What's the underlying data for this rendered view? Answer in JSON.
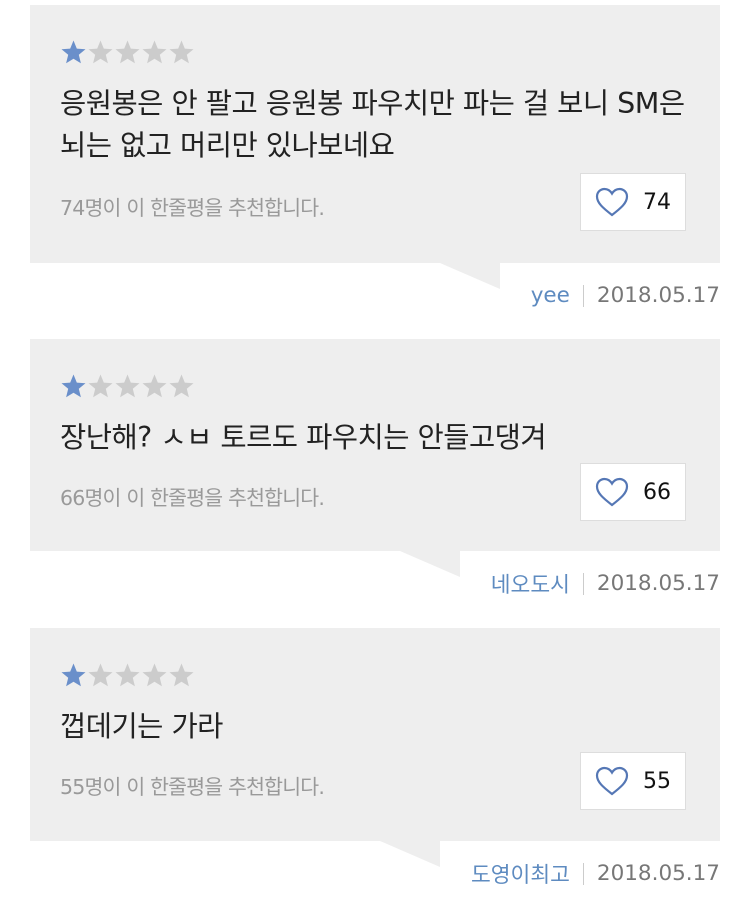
{
  "colors": {
    "bubble_bg": "#eeeeee",
    "star_filled": "#6a8fca",
    "star_empty": "#cccccc",
    "author_link": "#5e8bc0",
    "heart_outline": "#5577b5"
  },
  "icons": {
    "star": "star-icon",
    "heart": "heart-icon"
  },
  "reviews": [
    {
      "rating": 1,
      "max_rating": 5,
      "comment": "응원봉은 안 팔고 응원봉 파우치만 파는 걸 보니 SM은 뇌는 없고 머리만 있나보네요",
      "recommend_text": "74명이 이 한줄평을 추천합니다.",
      "likes": "74",
      "author": "yee",
      "date": "2018.05.17"
    },
    {
      "rating": 1,
      "max_rating": 5,
      "comment": "장난해? ㅅㅂ 토르도 파우치는 안들고댕겨",
      "recommend_text": "66명이 이 한줄평을 추천합니다.",
      "likes": "66",
      "author": "네오도시",
      "date": "2018.05.17"
    },
    {
      "rating": 1,
      "max_rating": 5,
      "comment": "껍데기는 가라",
      "recommend_text": "55명이 이 한줄평을 추천합니다.",
      "likes": "55",
      "author": "도영이최고",
      "date": "2018.05.17"
    }
  ]
}
